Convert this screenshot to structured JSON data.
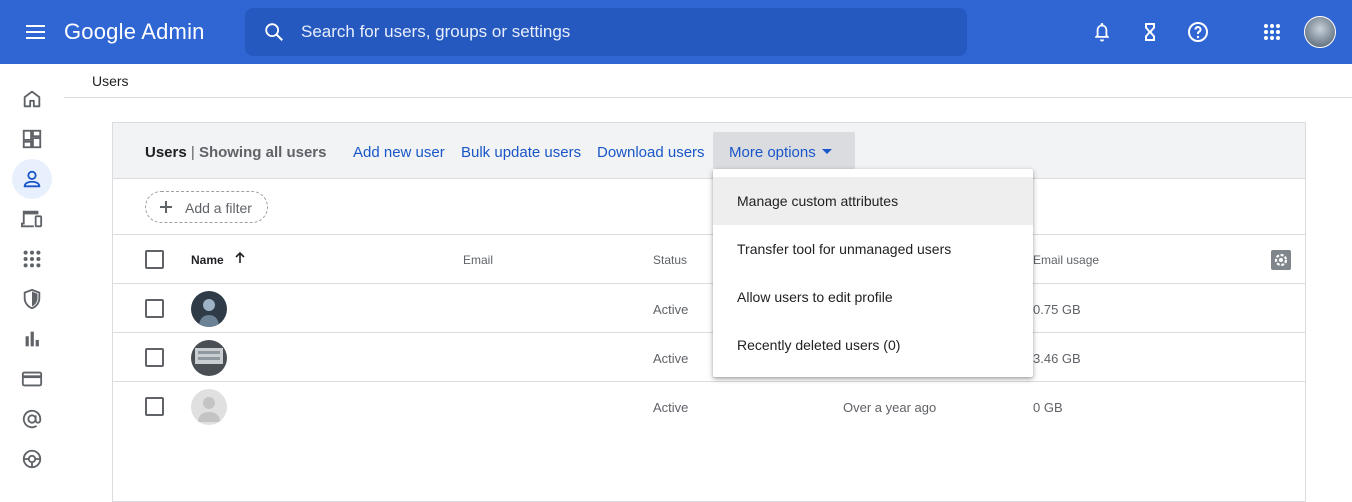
{
  "topbar": {
    "logo": "Google Admin",
    "search_placeholder": "Search for users, groups or settings",
    "brand_color": "#2f66d4"
  },
  "sidenav": {
    "items": [
      "home-icon",
      "dashboard-icon",
      "users-icon",
      "devices-icon",
      "apps-icon",
      "security-icon",
      "reports-icon",
      "billing-icon",
      "domains-icon",
      "support-icon"
    ],
    "active": "users-icon"
  },
  "breadcrumb": {
    "label": "Users"
  },
  "card": {
    "title": "Users",
    "separator": " | ",
    "subtitle": "Showing all users",
    "actions": {
      "add_new_user": "Add new user",
      "bulk_update_users": "Bulk update users",
      "download_users": "Download users",
      "more_options": "More options"
    },
    "add_filter": "Add a filter",
    "columns": {
      "name": "Name",
      "email": "Email",
      "status": "Status",
      "email_usage": "Email usage"
    },
    "rows": [
      {
        "status": "Active",
        "last_signin": "",
        "email_usage": "0.75 GB"
      },
      {
        "status": "Active",
        "last_signin": "",
        "email_usage": "3.46 GB"
      },
      {
        "status": "Active",
        "last_signin": "Over a year ago",
        "email_usage": "0 GB"
      }
    ]
  },
  "more_options_menu": {
    "items": [
      "Manage custom attributes",
      "Transfer tool for unmanaged users",
      "Allow users to edit profile",
      "Recently deleted users (0)"
    ],
    "highlighted_index": 0
  }
}
